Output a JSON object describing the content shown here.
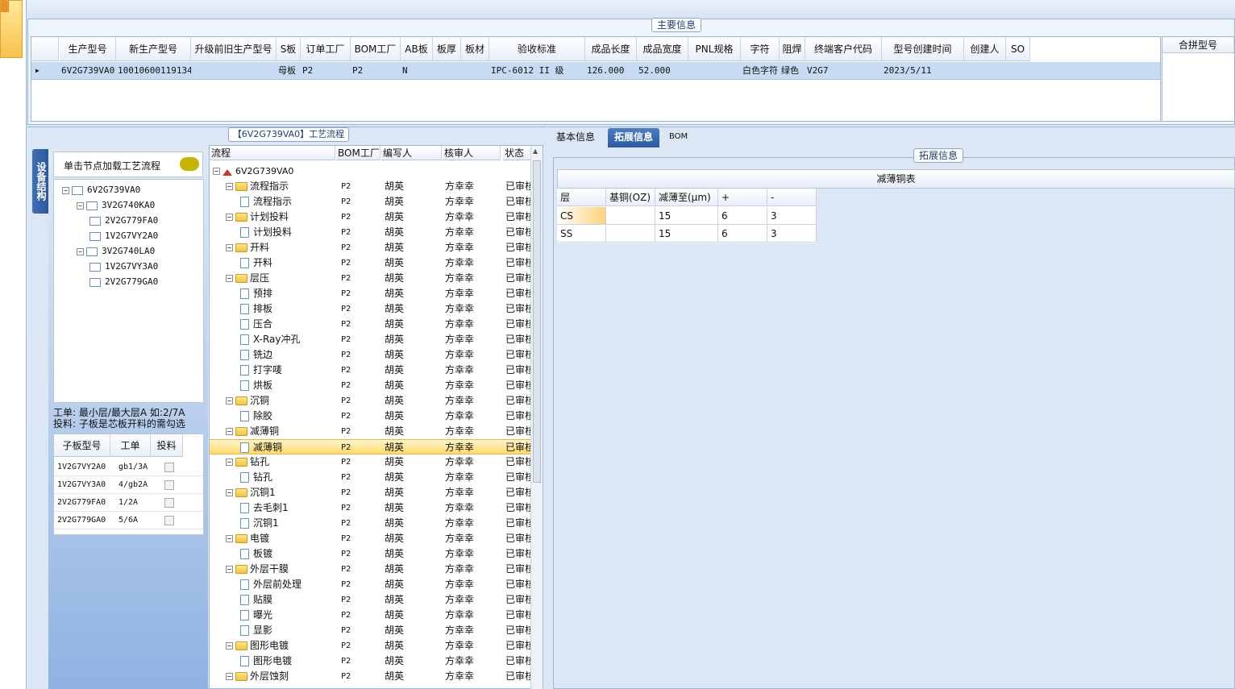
{
  "main_info": {
    "group_title": "主要信息",
    "columns": [
      "生产型号",
      "新生产型号",
      "升级前旧生产型号",
      "S板",
      "订单工厂",
      "BOM工厂",
      "AB板",
      "板厚",
      "板材",
      "验收标准",
      "成品长度",
      "成品宽度",
      "PNL规格",
      "字符",
      "阻焊",
      "终端客户代码",
      "型号创建时间",
      "创建人",
      "SO"
    ],
    "row": [
      "6V2G739VA0",
      "10010600119134",
      "",
      "母板",
      "P2",
      "P2",
      "N",
      "",
      "",
      "IPC-6012 II 级",
      "126.000",
      "52.000",
      "",
      "白色字符",
      "绿色",
      "V2G7",
      "2023/5/11",
      "",
      ""
    ],
    "side_header": "合拼型号"
  },
  "process_panel": {
    "title": "【6V2G739VA0】工艺流程",
    "vertical_tab": "设备结构",
    "node_load_label": "单击节点加载工艺流程",
    "tree": [
      {
        "label": "6V2G739VA0",
        "level": 0
      },
      {
        "label": "3V2G740KA0",
        "level": 1
      },
      {
        "label": "2V2G779FA0",
        "level": 2
      },
      {
        "label": "1V2G7VY2A0",
        "level": 2
      },
      {
        "label": "3V2G740LA0",
        "level": 1
      },
      {
        "label": "1V2G7VY3A0",
        "level": 2
      },
      {
        "label": "2V2G779GA0",
        "level": 2
      }
    ],
    "hint_line1": "工单: 最小层/最大层A 如:2/7A",
    "hint_line2": "投料: 子板是芯板开料的需勾选",
    "sub_columns": [
      "子板型号",
      "工单",
      "投料"
    ],
    "sub_rows": [
      {
        "model": "1V2G7VY2A0",
        "order": "gb1/3A"
      },
      {
        "model": "1V2G7VY3A0",
        "order": "4/gb2A"
      },
      {
        "model": "2V2G779FA0",
        "order": "1/2A"
      },
      {
        "model": "2V2G779GA0",
        "order": "5/6A"
      }
    ]
  },
  "flow_grid": {
    "columns": [
      "流程",
      "BOM工厂",
      "编写人",
      "核审人",
      "状态"
    ],
    "root": "6V2G739VA0",
    "rows": [
      {
        "name": "流程指示",
        "folder": true
      },
      {
        "name": "流程指示",
        "folder": false
      },
      {
        "name": "计划投料",
        "folder": true
      },
      {
        "name": "计划投料",
        "folder": false
      },
      {
        "name": "开料",
        "folder": true
      },
      {
        "name": "开料",
        "folder": false
      },
      {
        "name": "层压",
        "folder": true
      },
      {
        "name": "预排",
        "folder": false
      },
      {
        "name": "排板",
        "folder": false
      },
      {
        "name": "压合",
        "folder": false
      },
      {
        "name": "X-Ray冲孔",
        "folder": false
      },
      {
        "name": "铣边",
        "folder": false
      },
      {
        "name": "打字唛",
        "folder": false
      },
      {
        "name": "烘板",
        "folder": false
      },
      {
        "name": "沉铜",
        "folder": true
      },
      {
        "name": "除胶",
        "folder": false
      },
      {
        "name": "减薄铜",
        "folder": true
      },
      {
        "name": "减薄铜",
        "folder": false,
        "selected": true
      },
      {
        "name": "钻孔",
        "folder": true
      },
      {
        "name": "钻孔",
        "folder": false
      },
      {
        "name": "沉铜1",
        "folder": true
      },
      {
        "name": "去毛刺1",
        "folder": false
      },
      {
        "name": "沉铜1",
        "folder": false
      },
      {
        "name": "电镀",
        "folder": true
      },
      {
        "name": "板镀",
        "folder": false
      },
      {
        "name": "外层干膜",
        "folder": true
      },
      {
        "name": "外层前处理",
        "folder": false
      },
      {
        "name": "贴膜",
        "folder": false
      },
      {
        "name": "曝光",
        "folder": false
      },
      {
        "name": "显影",
        "folder": false
      },
      {
        "name": "图形电镀",
        "folder": true
      },
      {
        "name": "图形电镀",
        "folder": false
      },
      {
        "name": "外层蚀刻",
        "folder": true
      }
    ],
    "bom_factory": "P2",
    "writer": "胡英",
    "reviewer": "方幸幸",
    "status": "已审核"
  },
  "right_tabs": [
    "基本信息",
    "拓展信息",
    "BOM"
  ],
  "ext_group_title": "拓展信息",
  "thin_copper": {
    "title": "减薄铜表",
    "columns": [
      "层",
      "基铜(OZ)",
      "减薄至(μm)",
      "+",
      "-"
    ],
    "rows": [
      [
        "CS",
        "",
        "15",
        "6",
        "3"
      ],
      [
        "SS",
        "",
        "15",
        "6",
        "3"
      ]
    ]
  }
}
